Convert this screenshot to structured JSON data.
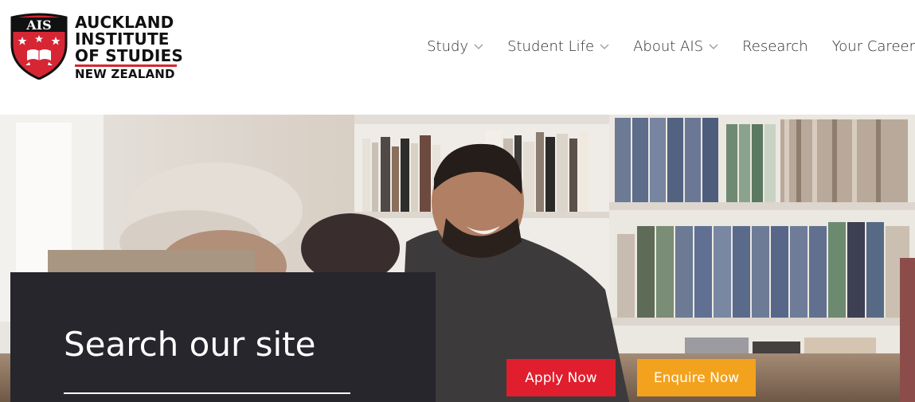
{
  "logo": {
    "badge_text": "AIS",
    "line1": "AUCKLAND",
    "line2": "INSTITUTE",
    "line3": "OF STUDIES",
    "line4": "NEW ZEALAND"
  },
  "nav": {
    "items": [
      {
        "label": "Study",
        "has_dropdown": true
      },
      {
        "label": "Student Life",
        "has_dropdown": true
      },
      {
        "label": "About AIS",
        "has_dropdown": true
      },
      {
        "label": "Research",
        "has_dropdown": false
      },
      {
        "label": "Your Career",
        "has_dropdown": false
      }
    ]
  },
  "search": {
    "title": "Search our site",
    "placeholder": ""
  },
  "cta": {
    "apply_label": "Apply Now",
    "enquire_label": "Enquire Now"
  },
  "colors": {
    "brand_red": "#d62634",
    "apply_bg": "#e01e2d",
    "enquire_bg": "#f3a21d",
    "panel_bg": "#26262c"
  }
}
